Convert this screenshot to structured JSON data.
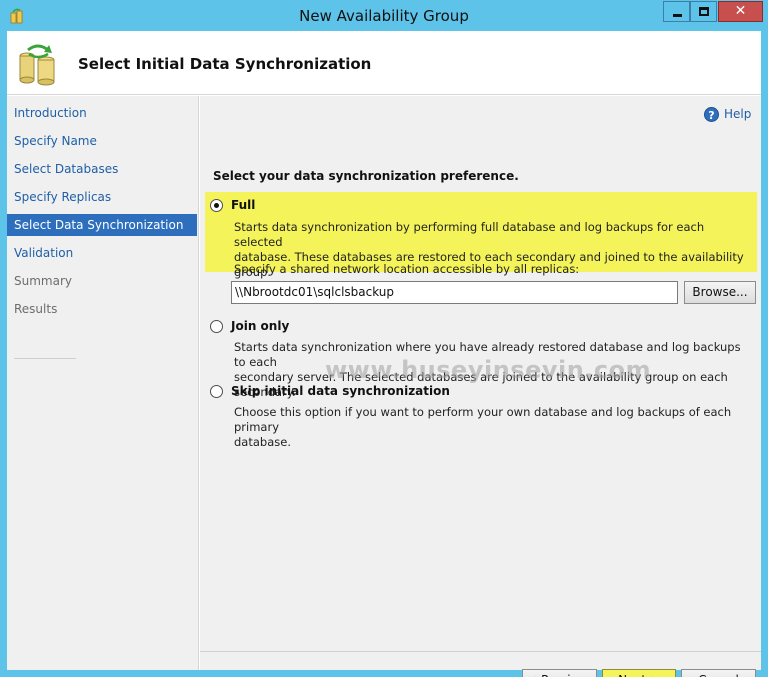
{
  "window": {
    "title": "New Availability Group",
    "close_glyph": "✕"
  },
  "header": {
    "title": "Select Initial Data Synchronization",
    "icon": "database-sync-icon"
  },
  "nav": {
    "items": [
      {
        "label": "Introduction",
        "state": "link"
      },
      {
        "label": "Specify Name",
        "state": "link"
      },
      {
        "label": "Select Databases",
        "state": "link"
      },
      {
        "label": "Specify Replicas",
        "state": "link"
      },
      {
        "label": "Select Data Synchronization",
        "state": "selected"
      },
      {
        "label": "Validation",
        "state": "link"
      },
      {
        "label": "Summary",
        "state": "disabled"
      },
      {
        "label": "Results",
        "state": "disabled"
      }
    ]
  },
  "main": {
    "help_label": "Help",
    "help_glyph": "?",
    "prompt": "Select your data synchronization preference.",
    "options": {
      "full": {
        "label": "Full",
        "checked": true,
        "description_line1": "Starts data synchronization by performing full database and log backups for each selected",
        "description_line2": "database. These databases are restored to each secondary and joined to the availability group."
      },
      "join_only": {
        "label": "Join only",
        "checked": false,
        "description_line1": "Starts data synchronization where you have already restored database and log backups to each",
        "description_line2": "secondary server. The selected databases are joined to the availability group on each secondary."
      },
      "skip": {
        "label": "Skip initial data synchronization",
        "checked": false,
        "description_line1": "Choose this option if you want to perform your own database and log backups of each primary",
        "description_line2": "database."
      }
    },
    "share_label": "Specify a shared network location accessible by all replicas:",
    "share_path": "\\\\Nbrootdc01\\sqlclsbackup",
    "browse_label": "Browse..."
  },
  "watermark": "www.huseyinsevin.com",
  "footer": {
    "previous_label": "< Previous",
    "next_label": "Next >",
    "cancel_label": "Cancel"
  },
  "colors": {
    "titlebar": "#5ec3e9",
    "highlight": "#f4f45a",
    "selected_nav": "#2d6fbd",
    "link": "#1f5fa6",
    "close_button": "#c7504f"
  }
}
